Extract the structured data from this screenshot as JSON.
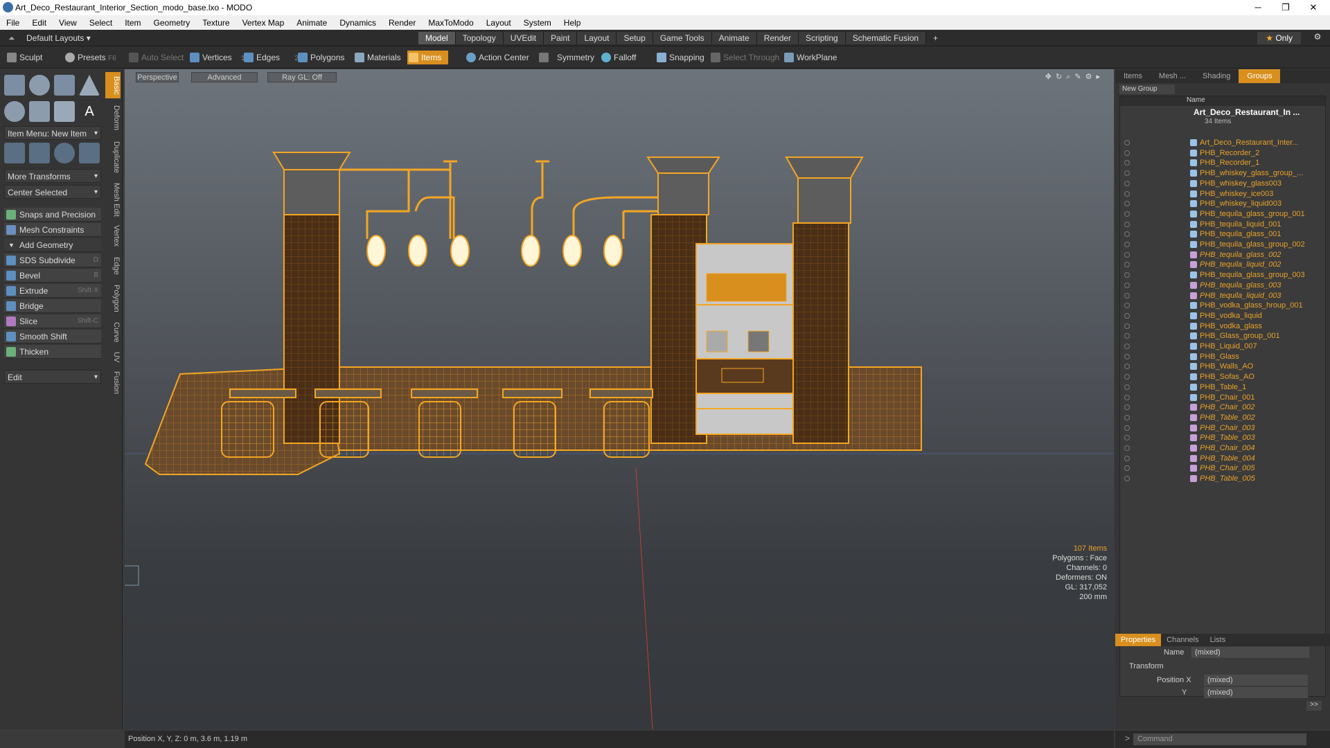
{
  "window": {
    "title": "Art_Deco_Restaurant_Interior_Section_modo_base.lxo - MODO",
    "min": "─",
    "max": "❐",
    "close": "✕"
  },
  "menu": [
    "File",
    "Edit",
    "View",
    "Select",
    "Item",
    "Geometry",
    "Texture",
    "Vertex Map",
    "Animate",
    "Dynamics",
    "Render",
    "MaxToModo",
    "Layout",
    "System",
    "Help"
  ],
  "tabbar": {
    "layout": "Default Layouts",
    "tabs": [
      "Model",
      "Topology",
      "UVEdit",
      "Paint",
      "Layout",
      "Setup",
      "Game Tools",
      "Animate",
      "Render",
      "Scripting",
      "Schematic Fusion"
    ],
    "active_tab": "Model",
    "plus": "+",
    "only": "Only"
  },
  "toolbar": {
    "sculpt": "Sculpt",
    "presets": "Presets",
    "presets_key": "F6",
    "auto_select": "Auto Select",
    "vertices": "Vertices",
    "vertices_n": "1",
    "edges": "Edges",
    "edges_n": "2",
    "polygons": "Polygons",
    "materials": "Materials",
    "items": "Items",
    "action_center": "Action Center",
    "symmetry": "Symmetry",
    "falloff": "Falloff",
    "snapping": "Snapping",
    "select_through": "Select Through",
    "workplane": "WorkPlane"
  },
  "left": {
    "item_menu": "Item Menu: New Item",
    "more_transforms": "More Transforms",
    "center_selected": "Center Selected",
    "snaps": "Snaps and Precision",
    "mesh_constraints": "Mesh Constraints",
    "add_geometry": "Add Geometry",
    "tools": [
      {
        "label": "SDS Subdivide",
        "key": "D"
      },
      {
        "label": "Bevel",
        "key": "B"
      },
      {
        "label": "Extrude",
        "key": "Shift-X"
      },
      {
        "label": "Bridge",
        "key": ""
      },
      {
        "label": "Slice",
        "key": "Shift-C"
      },
      {
        "label": "Smooth Shift",
        "key": ""
      },
      {
        "label": "Thicken",
        "key": ""
      }
    ],
    "edit": "Edit",
    "vtabs": [
      "Basic",
      "Deform",
      "Duplicate",
      "Mesh Edit",
      "Vertex",
      "Edge",
      "Polygon",
      "Curve",
      "UV",
      "Fusion"
    ]
  },
  "viewport": {
    "perspective": "Perspective",
    "advanced": "Advanced",
    "raygl": "Ray GL: Off",
    "info": [
      "107 Items",
      "Polygons : Face",
      "Channels: 0",
      "Deformers: ON",
      "GL: 317,052",
      "200 mm"
    ]
  },
  "status": {
    "position": "Position X, Y, Z:  0 m, 3.6 m, 1.19 m"
  },
  "right": {
    "tabs": [
      "Items",
      "Mesh ...",
      "Shading",
      "Groups"
    ],
    "active_tab": "Groups",
    "new_group": "New Group",
    "name_header": "Name",
    "group_name": "Art_Deco_Restaurant_In ...",
    "group_count": "34 Items",
    "items": [
      {
        "name": "Art_Deco_Restaurant_Inter...",
        "mat": false
      },
      {
        "name": "PHB_Recorder_2",
        "mat": false
      },
      {
        "name": "PHB_Recorder_1",
        "mat": false
      },
      {
        "name": "PHB_whiskey_glass_group_...",
        "mat": false
      },
      {
        "name": "PHB_whiskey_glass003",
        "mat": false
      },
      {
        "name": "PHB_whiskey_ice003",
        "mat": false
      },
      {
        "name": "PHB_whiskey_liquid003",
        "mat": false
      },
      {
        "name": "PHB_tequila_glass_group_001",
        "mat": false
      },
      {
        "name": "PHB_tequila_liquid_001",
        "mat": false
      },
      {
        "name": "PHB_tequila_glass_001",
        "mat": false
      },
      {
        "name": "PHB_tequila_glass_group_002",
        "mat": false
      },
      {
        "name": "PHB_tequila_glass_002",
        "mat": true
      },
      {
        "name": "PHB_tequila_liquid_002",
        "mat": true
      },
      {
        "name": "PHB_tequila_glass_group_003",
        "mat": false
      },
      {
        "name": "PHB_tequila_glass_003",
        "mat": true
      },
      {
        "name": "PHB_tequila_liquid_003",
        "mat": true
      },
      {
        "name": "PHB_vodka_glass_hroup_001",
        "mat": false
      },
      {
        "name": "PHB_vodka_liquid",
        "mat": false
      },
      {
        "name": "PHB_vodka_glass",
        "mat": false
      },
      {
        "name": "PHB_Glass_group_001",
        "mat": false
      },
      {
        "name": "PHB_Liquid_007",
        "mat": false
      },
      {
        "name": "PHB_Glass",
        "mat": false
      },
      {
        "name": "PHB_Walls_AO",
        "mat": false
      },
      {
        "name": "PHB_Sofas_AO",
        "mat": false
      },
      {
        "name": "PHB_Table_1",
        "mat": false
      },
      {
        "name": "PHB_Chair_001",
        "mat": false
      },
      {
        "name": "PHB_Chair_002",
        "mat": true
      },
      {
        "name": "PHB_Table_002",
        "mat": true
      },
      {
        "name": "PHB_Chair_003",
        "mat": true
      },
      {
        "name": "PHB_Table_003",
        "mat": true
      },
      {
        "name": "PHB_Chair_004",
        "mat": true
      },
      {
        "name": "PHB_Table_004",
        "mat": true
      },
      {
        "name": "PHB_Chair_005",
        "mat": true
      },
      {
        "name": "PHB_Table_005",
        "mat": true
      }
    ],
    "props_tabs": [
      "Properties",
      "Channels",
      "Lists"
    ],
    "name_label": "Name",
    "name_value": "(mixed)",
    "transform": "Transform",
    "posx_label": "Position X",
    "posx_value": "(mixed)",
    "y_label": "Y",
    "y_value": "(mixed)",
    "more": ">>",
    "command": "Command"
  },
  "colors": {
    "accent": "#d88f1e",
    "wire": "#f5a623",
    "wood": "#5a3a1e"
  }
}
